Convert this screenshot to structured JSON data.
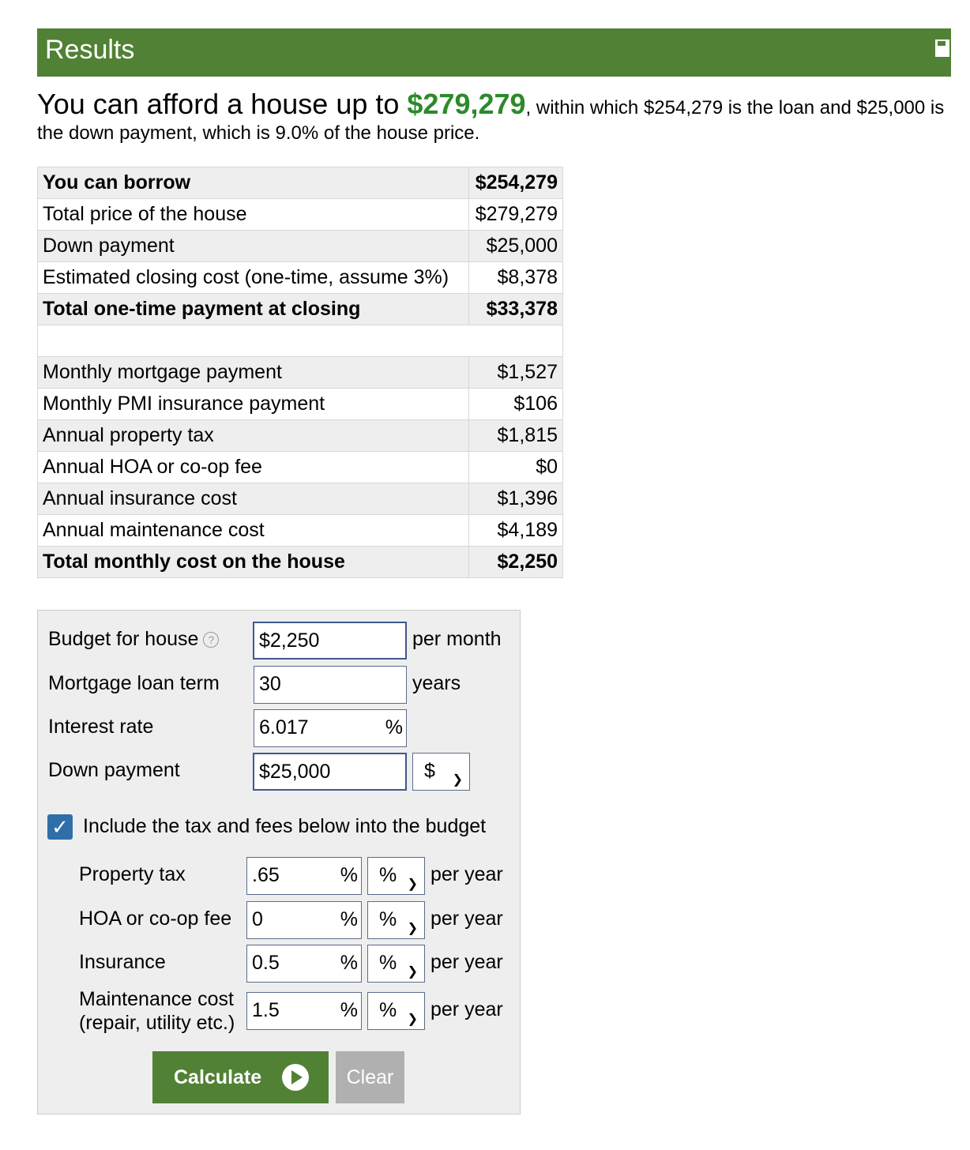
{
  "header": {
    "title": "Results",
    "save_label": "sa"
  },
  "summary": {
    "prefix": "You can afford a house up to ",
    "house_price": "$279,279",
    "suffix": ", within which $254,279 is the loan and $25,000 is the down payment, which is 9.0% of the house price."
  },
  "results_table": {
    "rows1": [
      {
        "label": "You can borrow",
        "value": "$254,279"
      },
      {
        "label": "Total price of the house",
        "value": "$279,279"
      },
      {
        "label": "Down payment",
        "value": "$25,000"
      },
      {
        "label": "Estimated closing cost (one-time, assume 3%)",
        "value": "$8,378"
      },
      {
        "label": "Total one-time payment at closing",
        "value": "$33,378"
      }
    ],
    "rows2": [
      {
        "label": "Monthly mortgage payment",
        "value": "$1,527"
      },
      {
        "label": "Monthly PMI insurance payment",
        "value": "$106"
      },
      {
        "label": "Annual property tax",
        "value": "$1,815"
      },
      {
        "label": "Annual HOA or co-op fee",
        "value": "$0"
      },
      {
        "label": "Annual insurance cost",
        "value": "$1,396"
      },
      {
        "label": "Annual maintenance cost",
        "value": "$4,189"
      },
      {
        "label": "Total monthly cost on the house",
        "value": "$2,250"
      }
    ]
  },
  "form": {
    "budget": {
      "label": "Budget for house",
      "value": "$2,250",
      "unit": "per month",
      "help": "?"
    },
    "term": {
      "label": "Mortgage loan term",
      "value": "30",
      "unit": "years"
    },
    "rate": {
      "label": "Interest rate",
      "value": "6.017",
      "unit": "%"
    },
    "down": {
      "label": "Down payment",
      "value": "$25,000",
      "select": "$"
    },
    "include": {
      "label": "Include the tax and fees below into the budget",
      "checked": true
    },
    "property_tax": {
      "label": "Property tax",
      "value": ".65",
      "pct": "%",
      "select": "%",
      "unit": "per year"
    },
    "hoa": {
      "label": "HOA or co-op fee",
      "value": "0",
      "pct": "%",
      "select": "%",
      "unit": "per year"
    },
    "insurance": {
      "label": "Insurance",
      "value": "0.5",
      "pct": "%",
      "select": "%",
      "unit": "per year"
    },
    "maintenance": {
      "label1": "Maintenance cost",
      "label2": "(repair, utility etc.)",
      "value": "1.5",
      "pct": "%",
      "select": "%",
      "unit": "per year"
    },
    "calculate_label": "Calculate",
    "clear_label": "Clear"
  },
  "colors": {
    "brand_green": "#518135",
    "amount_green": "#2c8a2a",
    "checkbox_blue": "#2f6ea9"
  }
}
